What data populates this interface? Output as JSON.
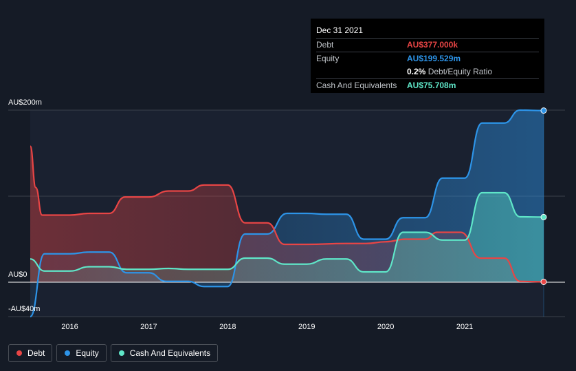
{
  "tooltip": {
    "date": "Dec 31 2021",
    "rows": [
      {
        "label": "Debt",
        "value": "AU$377.000k",
        "color": "#e84545"
      },
      {
        "label": "Equity",
        "value": "AU$199.529m",
        "color": "#2d94e8"
      },
      {
        "label": "",
        "value": "0.2%",
        "extra": "Debt/Equity Ratio",
        "color": "#ffffff"
      },
      {
        "label": "Cash And Equivalents",
        "value": "AU$75.708m",
        "color": "#5fe6c8"
      }
    ]
  },
  "legend": [
    {
      "label": "Debt",
      "color": "#e84545"
    },
    {
      "label": "Equity",
      "color": "#2d94e8"
    },
    {
      "label": "Cash And Equivalents",
      "color": "#5fe6c8"
    }
  ],
  "chart_data": {
    "type": "area",
    "x_ticks": [
      "2016",
      "2017",
      "2018",
      "2019",
      "2020",
      "2021"
    ],
    "y_ticks": [
      {
        "value": 200,
        "label": "AU$200m"
      },
      {
        "value": 0,
        "label": "AU$0"
      },
      {
        "value": -40,
        "label": "-AU$40m"
      }
    ],
    "ylim": [
      -40,
      200
    ],
    "xlim": [
      2015.5,
      2022.0
    ],
    "series": [
      {
        "name": "Debt",
        "color": "#e84545",
        "points": [
          [
            2015.5,
            158
          ],
          [
            2015.57,
            110
          ],
          [
            2015.65,
            78
          ],
          [
            2016.0,
            78
          ],
          [
            2016.25,
            80
          ],
          [
            2016.5,
            80
          ],
          [
            2016.7,
            99
          ],
          [
            2017.0,
            99
          ],
          [
            2017.25,
            106
          ],
          [
            2017.5,
            106
          ],
          [
            2017.7,
            113
          ],
          [
            2018.0,
            113
          ],
          [
            2018.22,
            69
          ],
          [
            2018.5,
            69
          ],
          [
            2018.72,
            44
          ],
          [
            2019.0,
            44
          ],
          [
            2019.5,
            45
          ],
          [
            2019.75,
            45
          ],
          [
            2020.0,
            47
          ],
          [
            2020.25,
            50
          ],
          [
            2020.5,
            50
          ],
          [
            2020.65,
            58
          ],
          [
            2020.95,
            58
          ],
          [
            2021.2,
            28
          ],
          [
            2021.5,
            28
          ],
          [
            2021.7,
            1
          ],
          [
            2022.0,
            0.4
          ]
        ]
      },
      {
        "name": "Equity",
        "color": "#2d94e8",
        "points": [
          [
            2015.5,
            -40
          ],
          [
            2015.68,
            33
          ],
          [
            2016.0,
            33
          ],
          [
            2016.25,
            35
          ],
          [
            2016.5,
            35
          ],
          [
            2016.72,
            11
          ],
          [
            2017.0,
            11
          ],
          [
            2017.22,
            1
          ],
          [
            2017.5,
            1
          ],
          [
            2017.7,
            -5
          ],
          [
            2018.0,
            -5
          ],
          [
            2018.22,
            56
          ],
          [
            2018.5,
            56
          ],
          [
            2018.75,
            80
          ],
          [
            2019.0,
            80
          ],
          [
            2019.25,
            79
          ],
          [
            2019.5,
            79
          ],
          [
            2019.72,
            50
          ],
          [
            2020.0,
            50
          ],
          [
            2020.22,
            75
          ],
          [
            2020.5,
            75
          ],
          [
            2020.72,
            121
          ],
          [
            2021.0,
            121
          ],
          [
            2021.22,
            185
          ],
          [
            2021.5,
            185
          ],
          [
            2021.7,
            200
          ],
          [
            2022.0,
            199.5
          ]
        ]
      },
      {
        "name": "Cash And Equivalents",
        "color": "#5fe6c8",
        "points": [
          [
            2015.5,
            27
          ],
          [
            2015.68,
            13
          ],
          [
            2016.0,
            13
          ],
          [
            2016.25,
            18
          ],
          [
            2016.5,
            18
          ],
          [
            2016.72,
            15
          ],
          [
            2017.0,
            15
          ],
          [
            2017.25,
            16
          ],
          [
            2017.5,
            15
          ],
          [
            2018.0,
            15
          ],
          [
            2018.22,
            28
          ],
          [
            2018.5,
            28
          ],
          [
            2018.72,
            21
          ],
          [
            2019.0,
            21
          ],
          [
            2019.25,
            27
          ],
          [
            2019.5,
            27
          ],
          [
            2019.72,
            12
          ],
          [
            2020.0,
            12
          ],
          [
            2020.22,
            58
          ],
          [
            2020.5,
            58
          ],
          [
            2020.72,
            49
          ],
          [
            2021.0,
            49
          ],
          [
            2021.22,
            104
          ],
          [
            2021.5,
            104
          ],
          [
            2021.7,
            76
          ],
          [
            2022.0,
            75.7
          ]
        ]
      }
    ],
    "grid": true,
    "legend_position": "bottom-left"
  }
}
